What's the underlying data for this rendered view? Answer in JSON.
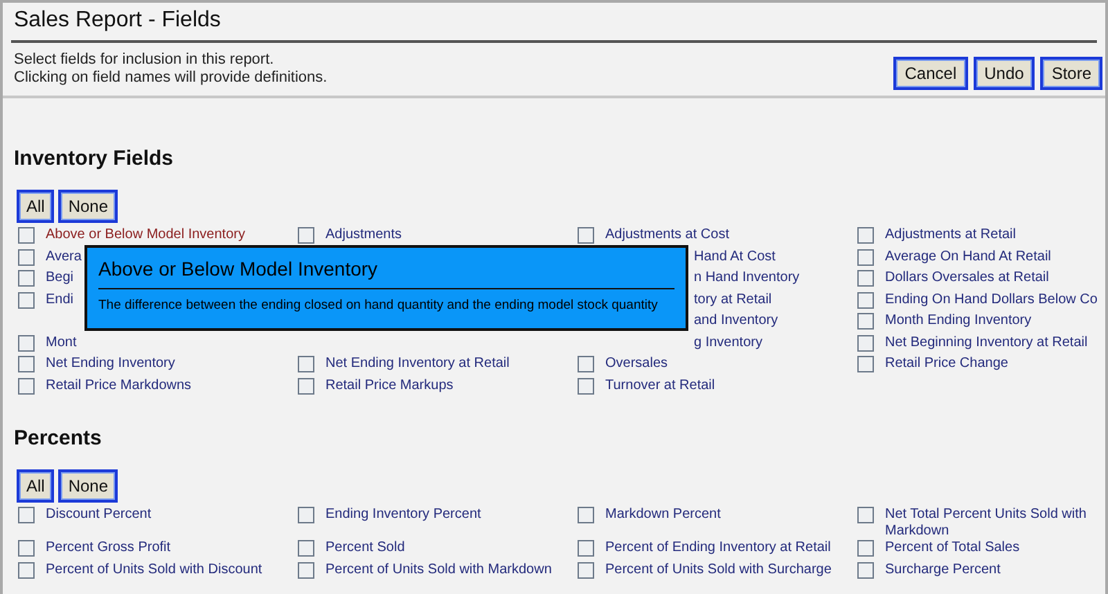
{
  "dialog": {
    "title": "Sales Report - Fields",
    "instructions": [
      "Select fields for inclusion in this report.",
      "Clicking on field names will provide definitions."
    ],
    "buttons": [
      "Cancel",
      "Undo",
      "Store"
    ]
  },
  "sections": [
    {
      "heading": "Inventory Fields",
      "buttons": [
        "All",
        "None"
      ],
      "rows": [
        [
          {
            "label": "Above or Below Model Inventory",
            "kind": "field",
            "checked": false,
            "active": true
          },
          {
            "label": "Adjustments",
            "kind": "field",
            "checked": false,
            "active": false
          },
          {
            "label": "Adjustments at Cost",
            "kind": "field",
            "checked": false,
            "active": false
          },
          {
            "label": "Adjustments at Retail",
            "kind": "field",
            "checked": false,
            "active": false
          }
        ],
        [
          {
            "label": "Avera",
            "kind": "field",
            "checked": false,
            "active": false
          },
          null,
          {
            "label": "Hand At Cost",
            "kind": "tail"
          },
          {
            "label": "Average On Hand At Retail",
            "kind": "field",
            "checked": false,
            "active": false
          }
        ],
        [
          {
            "label": "Begi",
            "kind": "field",
            "checked": false,
            "active": false
          },
          null,
          {
            "label": "n Hand Inventory",
            "kind": "tail"
          },
          {
            "label": "Dollars Oversales at Retail",
            "kind": "field",
            "checked": false,
            "active": false
          }
        ],
        [
          {
            "label": "Endi",
            "kind": "field",
            "checked": false,
            "active": false
          },
          null,
          {
            "label": "tory at Retail",
            "kind": "tail"
          },
          {
            "label": "Ending On Hand Dollars Below Co",
            "kind": "field",
            "checked": false,
            "active": false
          }
        ],
        [
          null,
          null,
          {
            "label": "and Inventory",
            "kind": "tail"
          },
          {
            "label": "Month Ending Inventory",
            "kind": "field",
            "checked": false,
            "active": false
          }
        ],
        [
          {
            "label": "Mont",
            "kind": "field",
            "checked": false,
            "active": false
          },
          null,
          {
            "label": "g Inventory",
            "kind": "tail"
          },
          {
            "label": "Net Beginning Inventory at Retail",
            "kind": "field",
            "checked": false,
            "active": false
          }
        ],
        [
          {
            "label": "Net Ending Inventory",
            "kind": "field",
            "checked": false,
            "active": false
          },
          {
            "label": "Net Ending Inventory at Retail",
            "kind": "field",
            "checked": false,
            "active": false
          },
          {
            "label": "Oversales",
            "kind": "field",
            "checked": false,
            "active": false
          },
          {
            "label": "Retail Price Change",
            "kind": "field",
            "checked": false,
            "active": false
          }
        ],
        [
          {
            "label": "Retail Price Markdowns",
            "kind": "field",
            "checked": false,
            "active": false
          },
          {
            "label": "Retail Price Markups",
            "kind": "field",
            "checked": false,
            "active": false
          },
          {
            "label": "Turnover at Retail",
            "kind": "field",
            "checked": false,
            "active": false
          },
          null
        ]
      ],
      "tooltip": {
        "title": "Above or Below Model Inventory",
        "text": "The difference between the ending closed on hand quantity and the ending model stock quantity"
      }
    },
    {
      "heading": "Percents",
      "buttons": [
        "All",
        "None"
      ],
      "rows": [
        [
          {
            "label": "Discount Percent",
            "kind": "field",
            "checked": false,
            "active": false
          },
          {
            "label": "Ending Inventory Percent",
            "kind": "field",
            "checked": false,
            "active": false
          },
          {
            "label": "Markdown Percent",
            "kind": "field",
            "checked": false,
            "active": false
          },
          {
            "label": "Net Total Percent Units Sold with Markdown",
            "kind": "field",
            "checked": false,
            "active": false
          }
        ],
        [
          {
            "label": "Percent Gross Profit",
            "kind": "field",
            "checked": false,
            "active": false
          },
          {
            "label": "Percent Sold",
            "kind": "field",
            "checked": false,
            "active": false
          },
          {
            "label": "Percent of Ending Inventory at Retail",
            "kind": "field",
            "checked": false,
            "active": false
          },
          {
            "label": "Percent of Total Sales",
            "kind": "field",
            "checked": false,
            "active": false
          }
        ],
        [
          {
            "label": "Percent of Units Sold with Discount",
            "kind": "field",
            "checked": false,
            "active": false
          },
          {
            "label": "Percent of Units Sold with Markdown",
            "kind": "field",
            "checked": false,
            "active": false
          },
          {
            "label": "Percent of Units Sold with Surcharge",
            "kind": "field",
            "checked": false,
            "active": false
          },
          {
            "label": "Surcharge Percent",
            "kind": "field",
            "checked": false,
            "active": false
          }
        ]
      ]
    }
  ]
}
